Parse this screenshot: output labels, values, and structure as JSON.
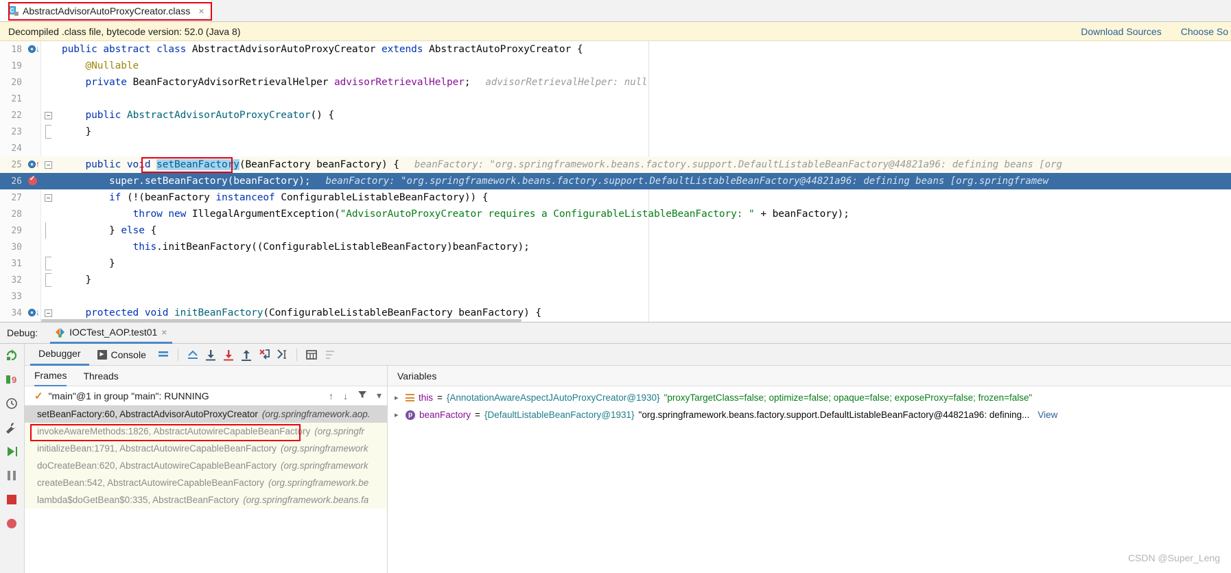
{
  "editor_tab": {
    "title": "AbstractAdvisorAutoProxyCreator.class",
    "close": "×",
    "icon_letter": "C"
  },
  "banner": {
    "text": "Decompiled .class file, bytecode version: 52.0 (Java 8)",
    "download_sources": "Download Sources",
    "choose_sources": "Choose So"
  },
  "code_lines": [
    {
      "num": "18",
      "indent": "",
      "text": "public abstract class AbstractAdvisorAutoProxyCreator extends AbstractAutoProxyCreator {"
    },
    {
      "num": "19",
      "indent": "    ",
      "text": "@Nullable"
    },
    {
      "num": "20",
      "indent": "    ",
      "text": "private BeanFactoryAdvisorRetrievalHelper advisorRetrievalHelper;",
      "hint": "advisorRetrievalHelper: null"
    },
    {
      "num": "21",
      "indent": "",
      "text": ""
    },
    {
      "num": "22",
      "indent": "    ",
      "text": "public AbstractAdvisorAutoProxyCreator() {"
    },
    {
      "num": "23",
      "indent": "    ",
      "text": "}"
    },
    {
      "num": "24",
      "indent": "",
      "text": ""
    },
    {
      "num": "25",
      "indent": "    ",
      "text": "public void setBeanFactory(BeanFactory beanFactory) {",
      "hint": "beanFactory: \"org.springframework.beans.factory.support.DefaultListableBeanFactory@44821a96: defining beans [org"
    },
    {
      "num": "26",
      "indent": "        ",
      "text": "super.setBeanFactory(beanFactory);",
      "hint": "beanFactory: \"org.springframework.beans.factory.support.DefaultListableBeanFactory@44821a96: defining beans [org.springframew"
    },
    {
      "num": "27",
      "indent": "        ",
      "text": "if (!(beanFactory instanceof ConfigurableListableBeanFactory)) {"
    },
    {
      "num": "28",
      "indent": "            ",
      "text": "throw new IllegalArgumentException(\"AdvisorAutoProxyCreator requires a ConfigurableListableBeanFactory: \" + beanFactory);"
    },
    {
      "num": "29",
      "indent": "        ",
      "text": "} else {"
    },
    {
      "num": "30",
      "indent": "            ",
      "text": "this.initBeanFactory((ConfigurableListableBeanFactory)beanFactory);"
    },
    {
      "num": "31",
      "indent": "        ",
      "text": "}"
    },
    {
      "num": "32",
      "indent": "    ",
      "text": "}"
    },
    {
      "num": "33",
      "indent": "",
      "text": ""
    },
    {
      "num": "34",
      "indent": "    ",
      "text": "protected void initBeanFactory(ConfigurableListableBeanFactory beanFactory) {"
    }
  ],
  "selected_token": "setBeanFactory",
  "debug": {
    "label": "Debug:",
    "run_config": "IOCTest_AOP.test01",
    "close": "×",
    "tabs": {
      "debugger": "Debugger",
      "console": "Console"
    },
    "sub_tabs": {
      "frames": "Frames",
      "threads": "Threads"
    },
    "thread": "\"main\"@1 in group \"main\": RUNNING",
    "frames": [
      {
        "method": "setBeanFactory:60, AbstractAdvisorAutoProxyCreator",
        "pkg": "(org.springframework.aop.",
        "selected": true
      },
      {
        "method": "invokeAwareMethods:1826, AbstractAutowireCapableBeanFactory",
        "pkg": "(org.springfr",
        "selected": false
      },
      {
        "method": "initializeBean:1791, AbstractAutowireCapableBeanFactory",
        "pkg": "(org.springframework",
        "selected": false
      },
      {
        "method": "doCreateBean:620, AbstractAutowireCapableBeanFactory",
        "pkg": "(org.springframework",
        "selected": false
      },
      {
        "method": "createBean:542, AbstractAutowireCapableBeanFactory",
        "pkg": "(org.springframework.be",
        "selected": false
      },
      {
        "method": "lambda$doGetBean$0:335, AbstractBeanFactory",
        "pkg": "(org.springframework.beans.fa",
        "selected": false
      }
    ],
    "variables_header": "Variables",
    "variables": [
      {
        "icon": "this-icon",
        "name": "this",
        "type": "{AnnotationAwareAspectJAutoProxyCreator@1930}",
        "value": "\"proxyTargetClass=false; optimize=false; opaque=false; exposeProxy=false; frozen=false\"",
        "view": ""
      },
      {
        "icon": "p-icon",
        "name": "beanFactory",
        "type": "{DefaultListableBeanFactory@1931}",
        "value": "\"org.springframework.beans.factory.support.DefaultListableBeanFactory@44821a96: defining...",
        "view": "View"
      }
    ]
  },
  "watermark": "CSDN @Super_Leng",
  "colors": {
    "highlight_box": "#e8000d",
    "exec_line": "#3a6ea5",
    "banner_bg": "#fdf6d8",
    "accent": "#4a88c7"
  }
}
